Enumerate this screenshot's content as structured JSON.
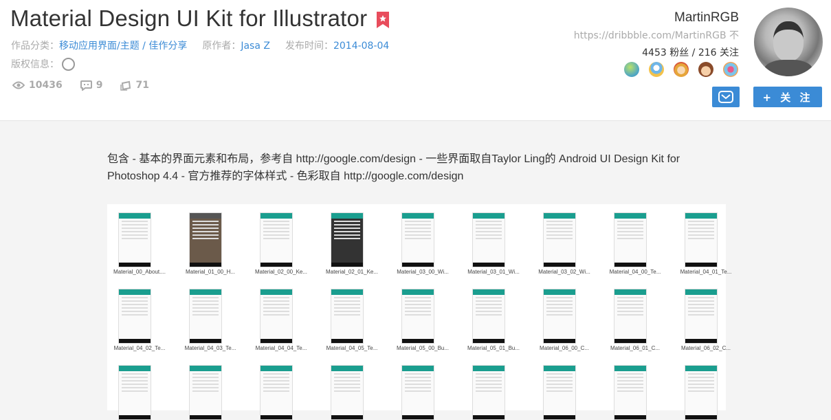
{
  "title": "Material Design UI Kit for Illustrator",
  "meta": {
    "category_label": "作品分类：",
    "category_value": "移动应用界面/主题 / 佳作分享",
    "author_label": "原作者：",
    "author_value": "Jasa Z",
    "date_label": "发布时间：",
    "date_value": "2014-08-04",
    "copyright_label": "版权信息："
  },
  "stats": {
    "views": "10436",
    "comments": "9",
    "likes": "71"
  },
  "author": {
    "name": "MartinRGB",
    "url": "https://dribbble.com/MartinRGB 不",
    "fans": "4453 粉丝 / 216 关注"
  },
  "buttons": {
    "follow": "+ 关 注"
  },
  "description": "包含 - 基本的界面元素和布局，参考自 http://google.com/design - 一些界面取自Taylor Ling的 Android UI Design Kit for Photoshop 4.4 - 官方推荐的字体样式 - 色彩取自 http://google.com/design",
  "colors": {
    "accent": "#3b8bd6",
    "flag": "#e84c5c",
    "teal": "#1a9e8f"
  },
  "thumbnails": [
    "Material_00_About....",
    "Material_01_00_H...",
    "Material_02_00_Ke...",
    "Material_02_01_Ke...",
    "Material_03_00_Wi...",
    "Material_03_01_Wi...",
    "Material_03_02_Wi...",
    "Material_04_00_Te...",
    "Material_04_01_Te...",
    "Material_04_02_Te...",
    "Material_04_03_Te...",
    "Material_04_04_Te...",
    "Material_04_05_Te...",
    "Material_05_00_Bu...",
    "Material_05_01_Bu...",
    "Material_06_00_C...",
    "Material_06_01_C...",
    "Material_06_02_C..."
  ]
}
